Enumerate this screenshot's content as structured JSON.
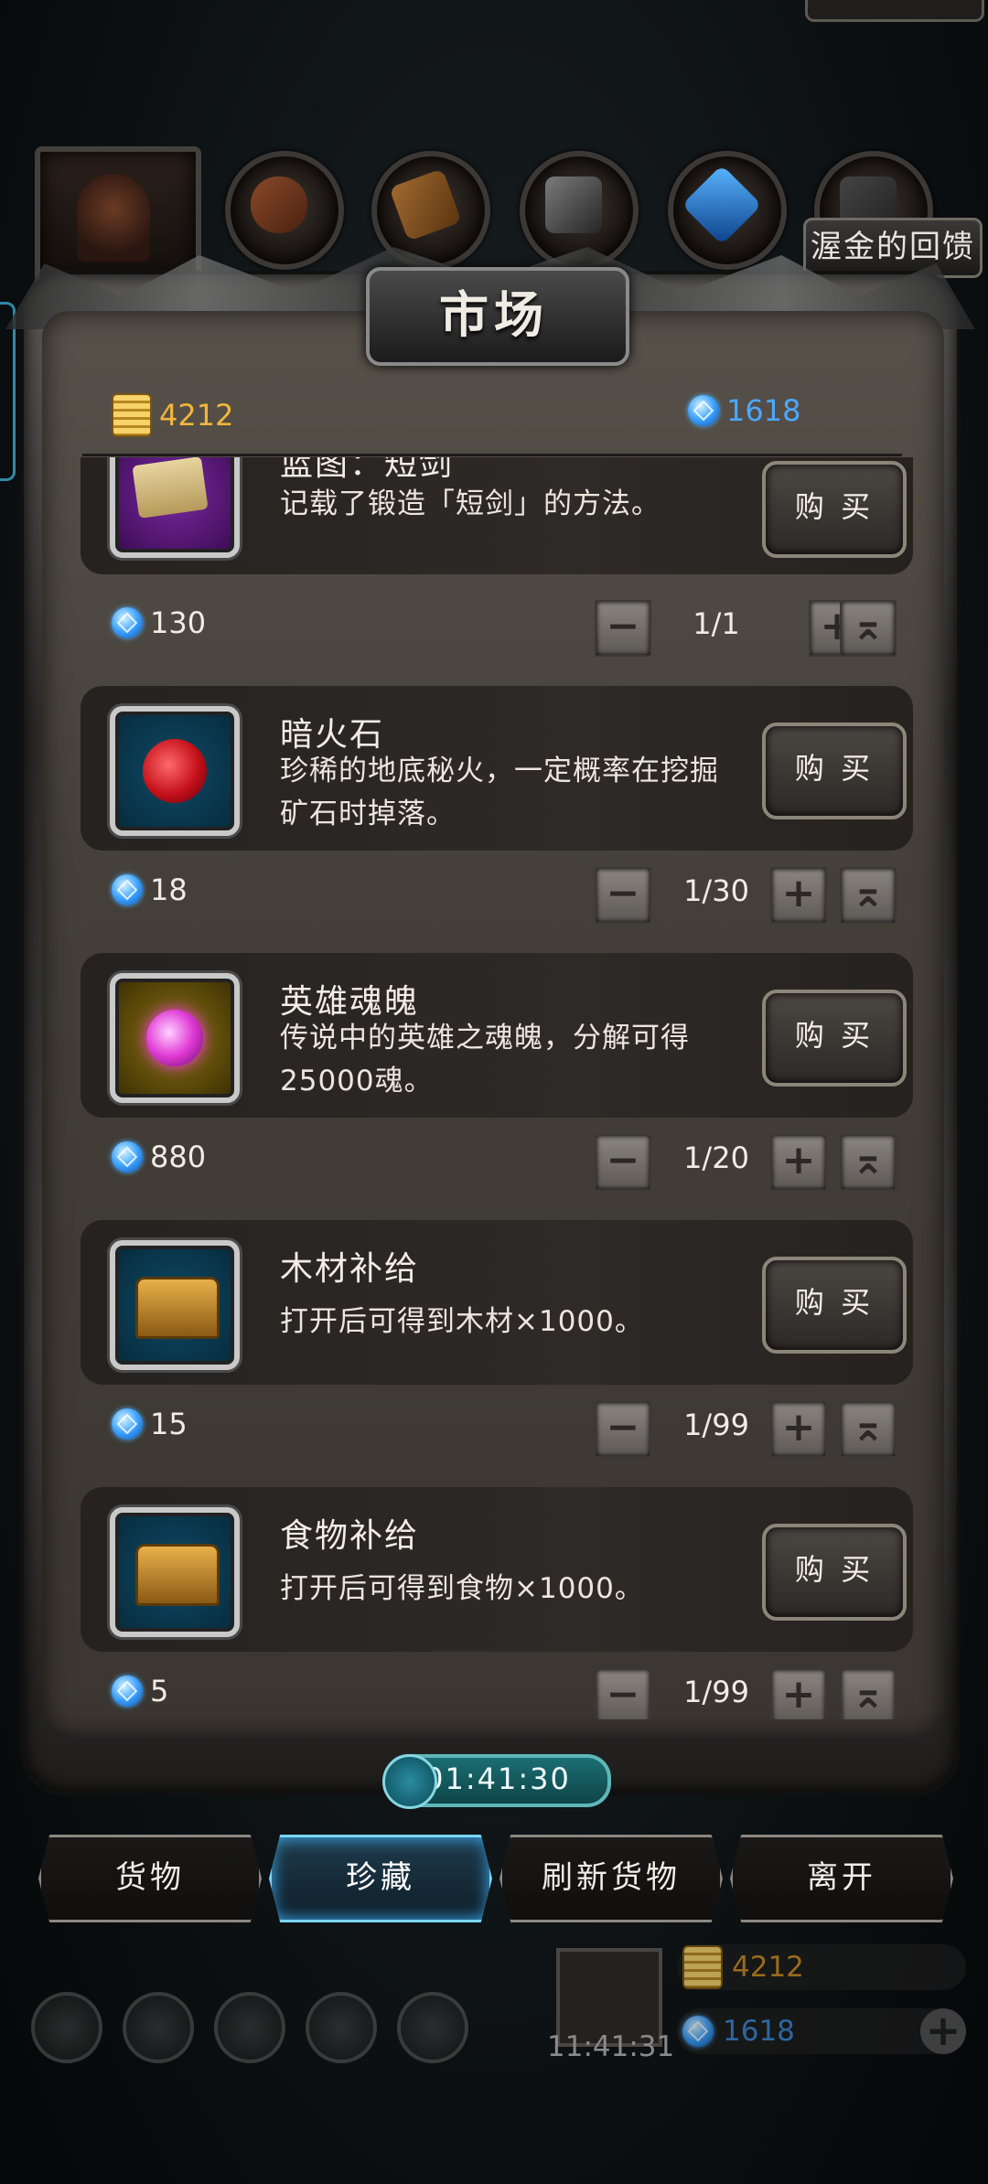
{
  "header": {
    "title": "市场",
    "promo_label": "渥金的回馈"
  },
  "currency": {
    "gold": "4212",
    "gems": "1618"
  },
  "items": [
    {
      "name": "蓝图：短剑",
      "desc": "记载了锻造「短剑」的方法。",
      "price": "130",
      "qty": "1/1",
      "icon": "scroll-icon",
      "frame_color": "#5a1e7a"
    },
    {
      "name": "暗火石",
      "desc": "珍稀的地底秘火，一定概率在挖掘矿石时掉落。",
      "price": "18",
      "qty": "1/30",
      "icon": "red-ore-icon",
      "frame_color": "#0e3a52"
    },
    {
      "name": "英雄魂魄",
      "desc": "传说中的英雄之魂魄，分解可得25000魂。",
      "price": "880",
      "qty": "1/20",
      "icon": "soul-orb-icon",
      "frame_color": "#7a6210"
    },
    {
      "name": "木材补给",
      "desc": "打开后可得到木材×1000。",
      "price": "15",
      "qty": "1/99",
      "icon": "treasure-chest-icon",
      "frame_color": "#0e3a52"
    },
    {
      "name": "食物补给",
      "desc": "打开后可得到食物×1000。",
      "price": "5",
      "qty": "1/99",
      "icon": "treasure-chest-icon",
      "frame_color": "#0e3a52"
    }
  ],
  "buy_label": "购 买",
  "timer": "01:41:30",
  "tabs": [
    {
      "label": "货物",
      "active": false
    },
    {
      "label": "珍藏",
      "active": true
    },
    {
      "label": "刷新货物",
      "active": false
    },
    {
      "label": "离开",
      "active": false
    }
  ],
  "bottom": {
    "time": "11:41:31",
    "gold": "4212",
    "gems": "1618"
  },
  "colors": {
    "gold_text": "#f2b63a",
    "gem_text": "#4aa8ff",
    "tab_active_glow": "#7bd6ff"
  }
}
